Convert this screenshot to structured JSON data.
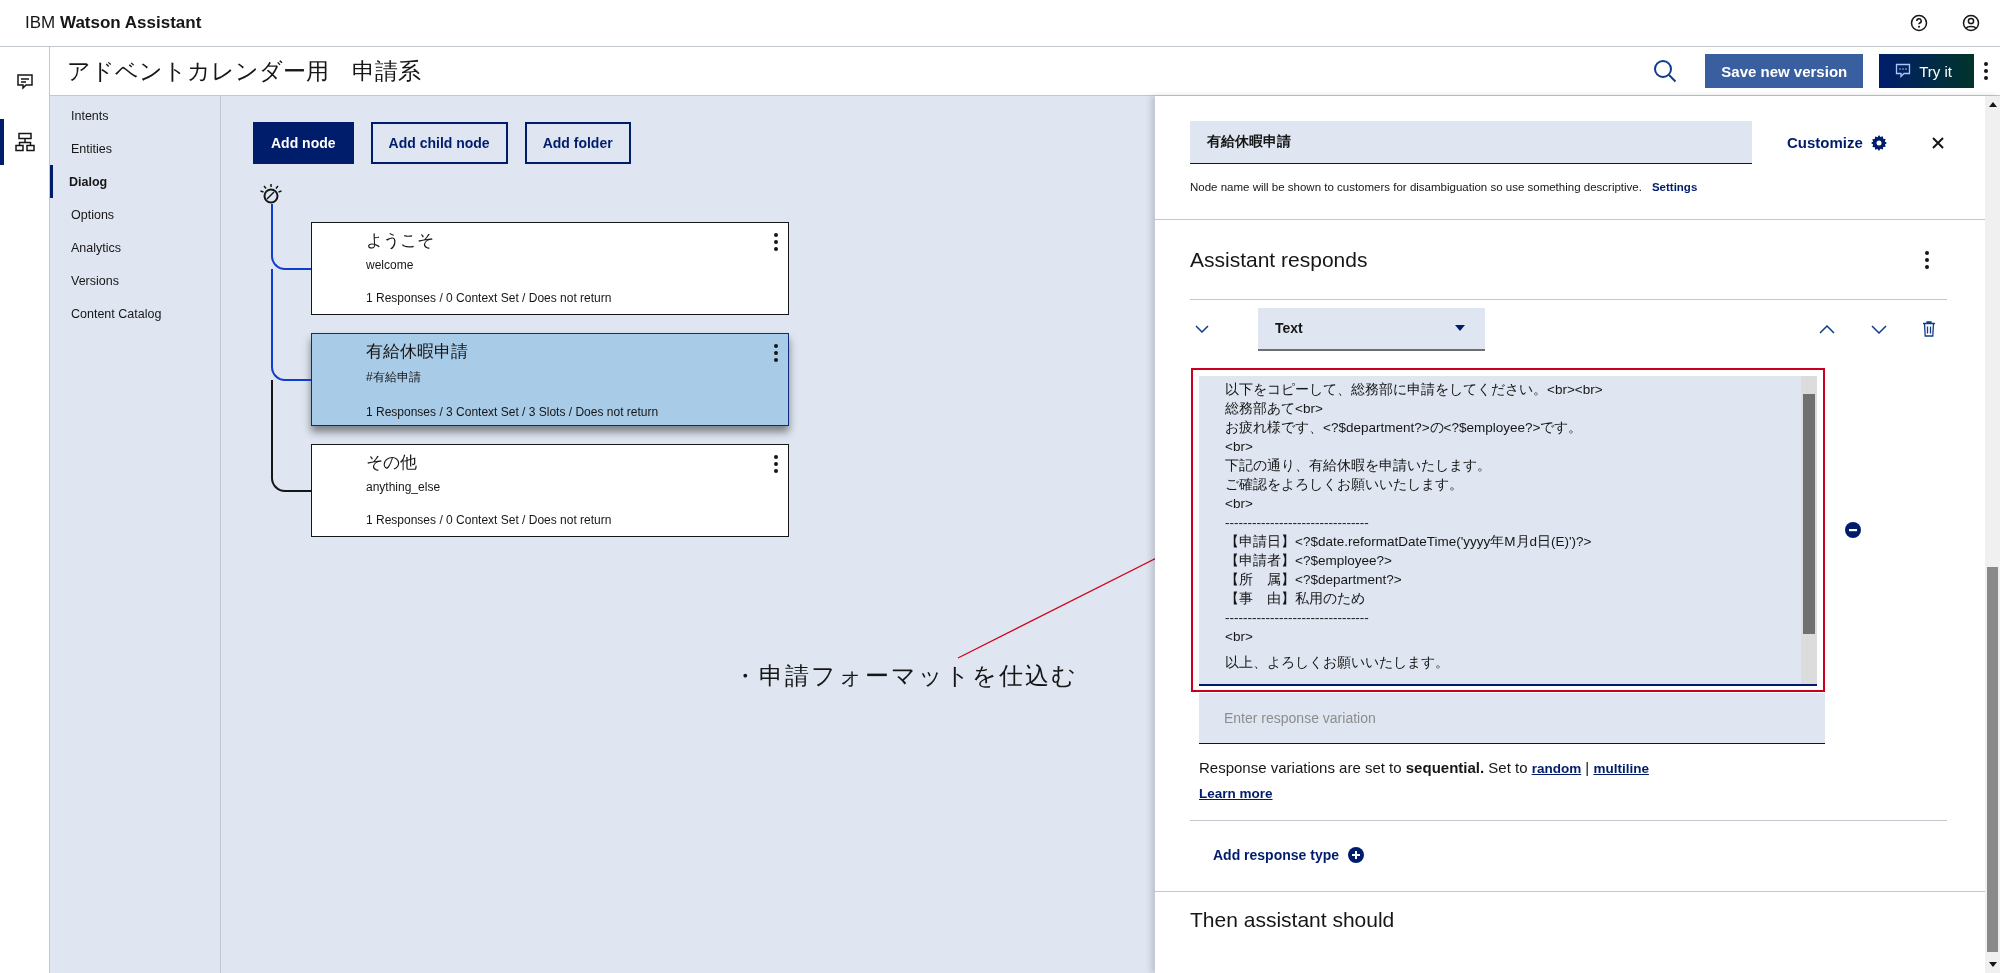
{
  "app": {
    "brand_prefix": "IBM",
    "brand_name": "Watson Assistant"
  },
  "rail": [
    {
      "kind": "chat",
      "selected": false
    },
    {
      "kind": "dialog",
      "selected": true
    }
  ],
  "header": {
    "title": "アドベントカレンダー用　申請系",
    "save_button": "Save new version",
    "try_button": "Try it"
  },
  "nav": [
    {
      "label": "Intents",
      "selected": false
    },
    {
      "label": "Entities",
      "selected": false
    },
    {
      "label": "Dialog",
      "selected": true
    },
    {
      "label": "Options",
      "selected": false
    },
    {
      "label": "Analytics",
      "selected": false
    },
    {
      "label": "Versions",
      "selected": false
    },
    {
      "label": "Content Catalog",
      "selected": false
    }
  ],
  "toolbar": [
    {
      "label": "Add node",
      "kind": "primary"
    },
    {
      "label": "Add child node",
      "kind": "secondary"
    },
    {
      "label": "Add folder",
      "kind": "secondary"
    }
  ],
  "nodes": [
    {
      "title": "ようこそ",
      "condition": "welcome",
      "summary": "1 Responses / 0 Context Set / Does not return",
      "selected": false
    },
    {
      "title": "有給休暇申請",
      "condition": "#有給申請",
      "summary": "1 Responses / 3 Context Set / 3 Slots / Does not return",
      "selected": true
    },
    {
      "title": "その他",
      "condition": "anything_else",
      "summary": "1 Responses / 0 Context Set / Does not return",
      "selected": false
    }
  ],
  "annotation": {
    "text": "・申請フォーマットを仕込む"
  },
  "panel": {
    "node_name": "有給休暇申請",
    "customize": "Customize",
    "hint": "Node name will be shown to customers for disambiguation so use something descriptive.",
    "hint_link": "Settings",
    "responds_title": "Assistant responds",
    "response_type": "Text",
    "variation_lines": [
      "以下をコピーして、総務部に申請をしてください。<br><br>",
      "総務部あて<br>",
      "お疲れ様です、<?$department?>の<?$employee?>です。",
      "<br>",
      "下記の通り、有給休暇を申請いたします。",
      "ご確認をよろしくお願いいたします。",
      "<br>",
      "--------------------------------",
      "【申請日】<?$date.reformatDateTime('yyyy年M月d日(E)')?>",
      "【申請者】<?$employee?>",
      "【所　属】<?$department?>",
      "【事　由】私用のため",
      "--------------------------------",
      "<br>"
    ],
    "variation_closing": "以上、よろしくお願いいたします。",
    "variation_placeholder": "Enter response variation",
    "mode_text": "Response variations are set to **sequential.** Set to",
    "links": [
      "random",
      "multiline"
    ],
    "separator": "|",
    "learn_more": "Learn more",
    "add_response": "Add response type",
    "then_title": "Then assistant should"
  }
}
